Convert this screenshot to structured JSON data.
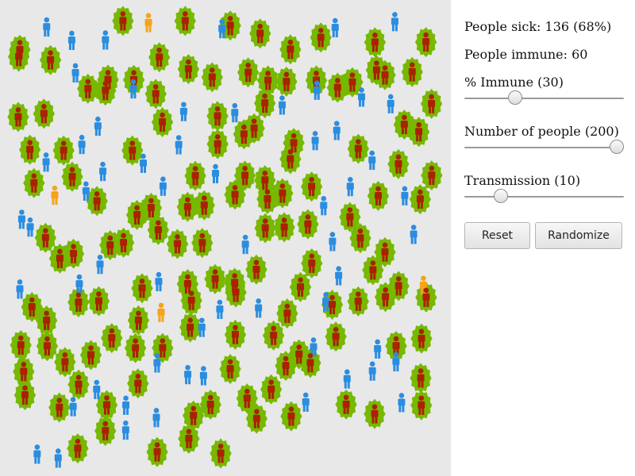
{
  "stats": {
    "people_sick": "People sick: 136 (68%)",
    "people_immune": "People immune: 60"
  },
  "controls": {
    "immune": {
      "label": "% Immune (30)",
      "value": 30,
      "min": 0,
      "max": 100
    },
    "people": {
      "label": "Number of people (200)",
      "value": 200,
      "min": 0,
      "max": 200
    },
    "transmission": {
      "label": "Transmission (10)",
      "value": 10,
      "min": 0,
      "max": 50
    }
  },
  "buttons": {
    "reset": "Reset",
    "randomize": "Randomize"
  },
  "population": {
    "sick": 136,
    "immune": 60,
    "healthy": 4
  },
  "colors": {
    "sick_person": "#aa2200",
    "sick_halo": "#77b800",
    "immune_person": "#2b8de0",
    "healthy_person": "#f5a41a",
    "canvas_background": "#e8e8e8"
  }
}
